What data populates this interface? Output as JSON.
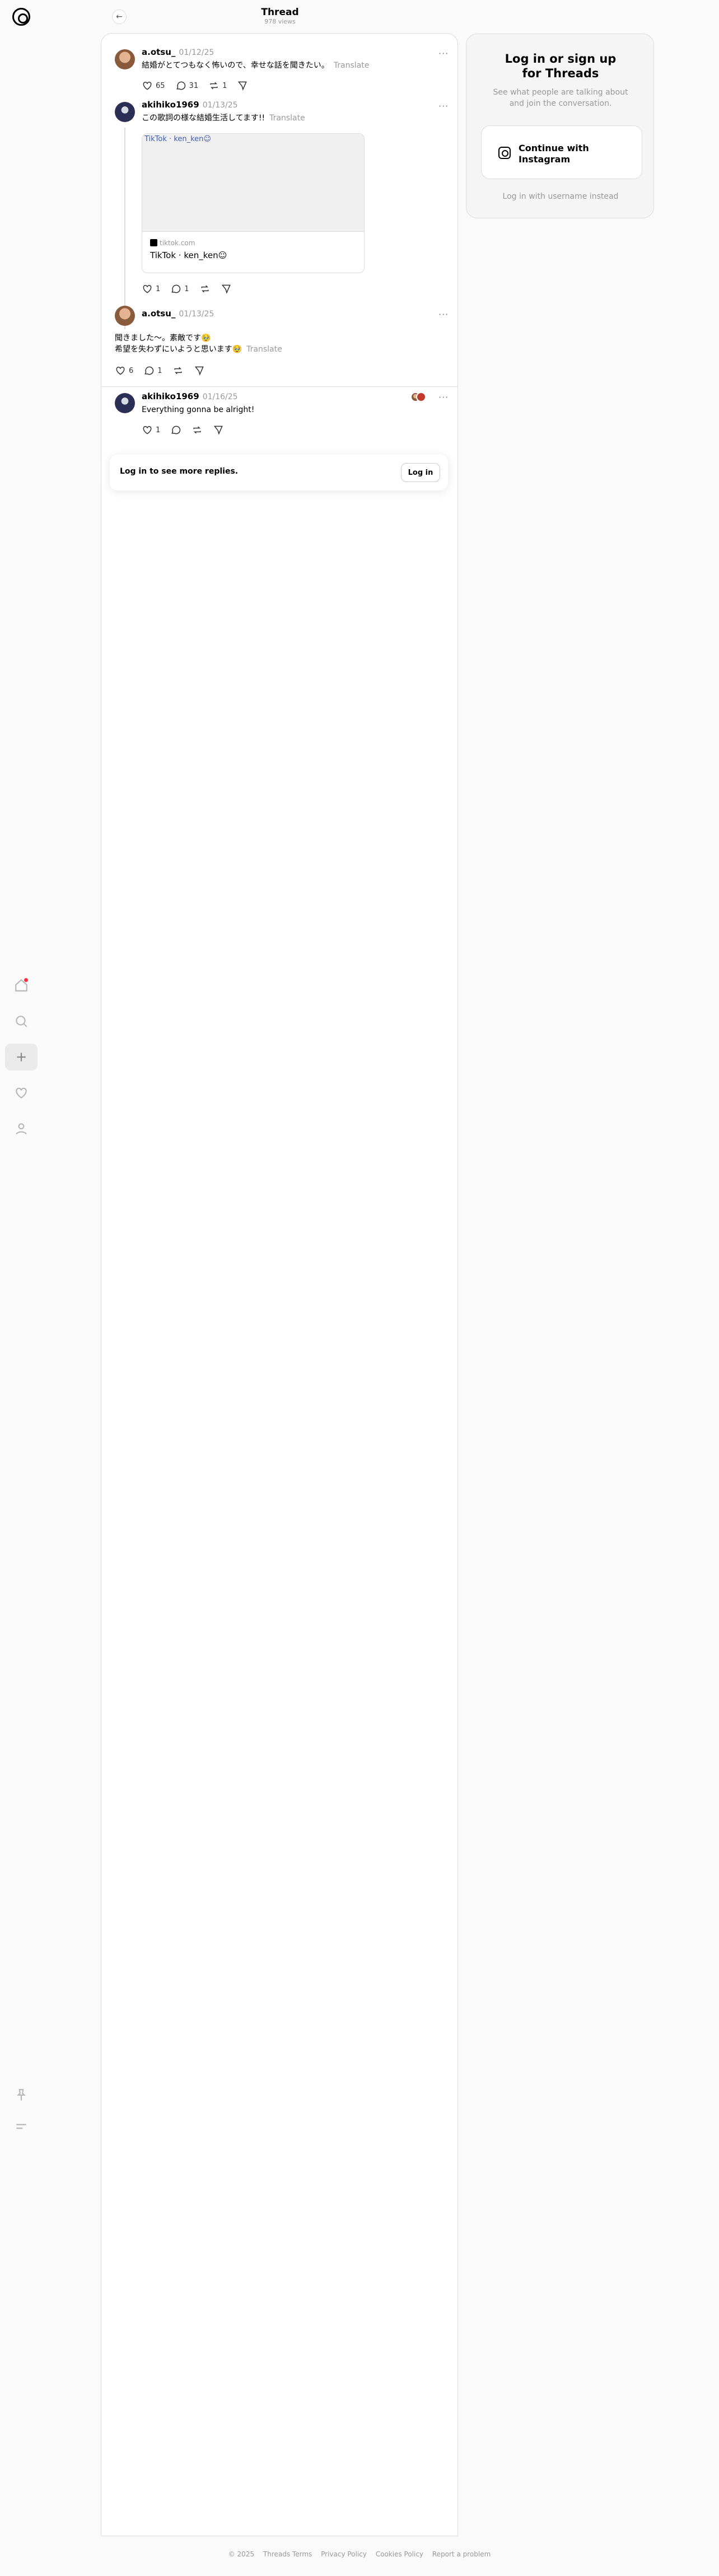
{
  "header": {
    "title": "Thread",
    "views": "978 views"
  },
  "posts": [
    {
      "user": "a.otsu_",
      "date": "01/12/25",
      "text": "結婚がとてつもなく怖いので、幸せな話を聞きたい。",
      "translate": "Translate",
      "likes": "65",
      "replies": "31",
      "reposts": "1"
    },
    {
      "user": "akihiko1969",
      "date": "01/13/25",
      "text": "この歌詞の様な結婚生活してます!!",
      "translate": "Translate",
      "likes": "1",
      "replies": "1",
      "reposts": "",
      "card": {
        "alt": "TikTok · ken_ken☺",
        "domain": "tiktok.com",
        "title": "TikTok · ken_ken☺"
      }
    },
    {
      "user": "a.otsu_",
      "date": "01/13/25",
      "line1": "聞きました〜。素敵です🥹",
      "line2": "希望を失わずにいようと思います🥹",
      "translate": "Translate",
      "likes": "6",
      "replies": "1",
      "reposts": ""
    },
    {
      "user": "akihiko1969",
      "date": "01/16/25",
      "text": "Everything gonna be alright!",
      "likes": "1",
      "replies": "",
      "reposts": ""
    }
  ],
  "login_prompt": {
    "text": "Log in to see more replies.",
    "button": "Log in"
  },
  "panel": {
    "title_line1": "Log in or sign up",
    "title_line2": "for Threads",
    "sub_line1": "See what people are talking about",
    "sub_line2": "and join the conversation.",
    "button_line1": "Continue with",
    "button_line2": "Instagram",
    "link": "Log in with username instead"
  },
  "footer": [
    "© 2025",
    "Threads Terms",
    "Privacy Policy",
    "Cookies Policy",
    "Report a problem"
  ],
  "colors": {
    "accent": "#000000",
    "notification": "#ff3040",
    "muted": "#999999"
  }
}
